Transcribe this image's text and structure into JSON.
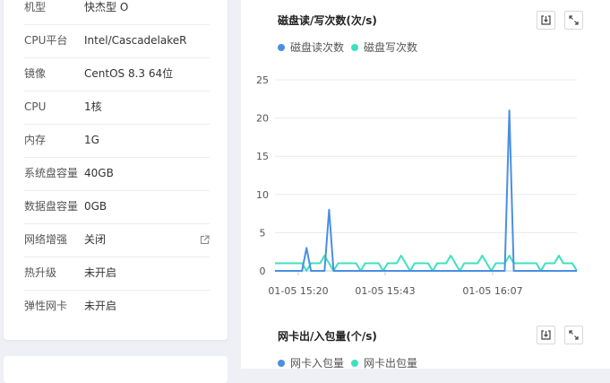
{
  "instance_specs": [
    {
      "label": "机型",
      "value": "快杰型 O"
    },
    {
      "label": "CPU平台",
      "value": "Intel/CascadelakeR"
    },
    {
      "label": "镜像",
      "value": "CentOS 8.3 64位"
    },
    {
      "label": "CPU",
      "value": "1核"
    },
    {
      "label": "内存",
      "value": "1G"
    },
    {
      "label": "系统盘容量",
      "value": "40GB"
    },
    {
      "label": "数据盘容量",
      "value": "0GB"
    },
    {
      "label": "网络增强",
      "value": "关闭"
    },
    {
      "label": "热升级",
      "value": "未开启"
    },
    {
      "label": "弹性网卡",
      "value": "未开启"
    }
  ],
  "icons": {
    "download": "download-icon",
    "fullscreen": "fullscreen-icon",
    "external_link": "external-link-icon"
  },
  "disk_chart": {
    "title": "磁盘读/写次数(次/s)",
    "legend": [
      {
        "name": "磁盘读次数",
        "color": "#4a8fe2"
      },
      {
        "name": "磁盘写次数",
        "color": "#3de0c0"
      }
    ]
  },
  "net_chart": {
    "title": "网卡出/入包量(个/s)",
    "legend": [
      {
        "name": "网卡入包量",
        "color": "#4a8fe2"
      },
      {
        "name": "网卡出包量",
        "color": "#3de0c0"
      }
    ]
  },
  "chart_data": {
    "type": "line",
    "title": "磁盘读/写次数(次/s)",
    "xlabel": "",
    "ylabel": "",
    "ylim": [
      0,
      25
    ],
    "yticks": [
      "25",
      "20",
      "15",
      "10",
      "5",
      "0"
    ],
    "xticks": [
      "01-05 15:20",
      "01-05 15:43",
      "01-05 16:07"
    ],
    "grid": true,
    "legend_position": "top-left",
    "x": [
      0,
      1,
      2,
      3,
      4,
      5,
      6,
      7,
      8,
      9,
      10,
      11,
      12,
      13,
      14,
      15,
      16,
      17,
      18,
      19,
      20,
      21,
      22,
      23,
      24,
      25,
      26,
      27,
      28,
      29,
      30,
      31,
      32,
      33,
      34,
      35,
      36,
      37,
      38,
      39,
      40,
      41,
      42,
      43,
      44,
      45,
      46,
      47,
      48,
      49,
      50,
      51,
      52,
      53,
      54,
      55,
      56,
      57,
      58,
      59,
      60,
      61,
      62,
      63,
      64,
      65,
      66,
      67
    ],
    "series": [
      {
        "name": "磁盘读次数",
        "color": "#4a8fe2",
        "values": [
          0,
          0,
          0,
          0,
          0,
          0,
          0,
          3,
          0,
          0,
          0,
          0,
          8,
          0,
          0,
          0,
          0,
          0,
          0,
          0,
          0,
          0,
          0,
          0,
          0,
          0,
          0,
          0,
          0,
          0,
          0,
          0,
          0,
          0,
          0,
          0,
          0,
          0,
          0,
          0,
          0,
          0,
          0,
          0,
          0,
          0,
          0,
          0,
          0,
          0,
          0,
          0,
          21,
          0,
          0,
          0,
          0,
          0,
          0,
          0,
          0,
          0,
          0,
          0,
          0,
          0,
          0,
          0
        ]
      },
      {
        "name": "磁盘写次数",
        "color": "#3de0c0",
        "values": [
          1,
          1,
          1,
          1,
          1,
          1,
          1,
          0,
          1,
          1,
          1,
          2,
          1,
          0,
          1,
          1,
          1,
          1,
          1,
          0,
          1,
          1,
          1,
          1,
          0,
          1,
          1,
          1,
          2,
          1,
          0,
          1,
          1,
          1,
          1,
          0,
          1,
          1,
          1,
          2,
          1,
          0,
          1,
          1,
          1,
          1,
          2,
          1,
          0,
          1,
          1,
          1,
          2,
          1,
          1,
          1,
          1,
          1,
          1,
          0,
          1,
          1,
          1,
          2,
          1,
          1,
          1,
          0
        ]
      }
    ]
  }
}
